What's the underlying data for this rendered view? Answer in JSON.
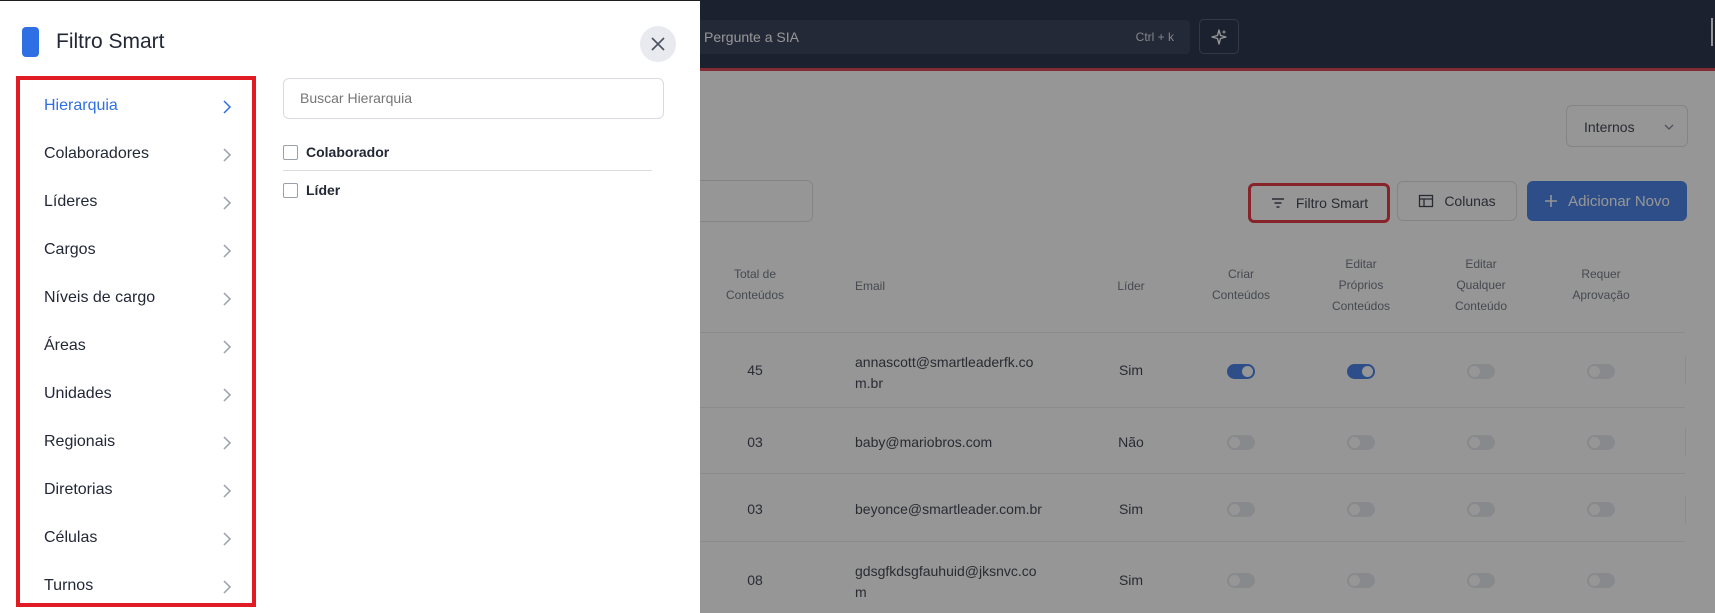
{
  "topbar": {
    "ask_placeholder": "Pergunte a SIA",
    "ask_shortcut": "Ctrl + k",
    "sparkle_icon": "sparkle-icon"
  },
  "toolbar": {
    "internos_value": "Internos",
    "filter_label": "Filtro Smart",
    "columns_label": "Colunas",
    "add_label": "Adicionar Novo",
    "accent_color": "#2f6fe4",
    "highlight_color": "#e01b24"
  },
  "table": {
    "headers": {
      "total": [
        "Total de",
        "Conteúdos"
      ],
      "email": "Email",
      "lider": "Líder",
      "criar": [
        "Criar",
        "Conteúdos"
      ],
      "editar_proprios": [
        "Editar",
        "Próprios",
        "Conteúdos"
      ],
      "editar_qualquer": [
        "Editar",
        "Qualquer",
        "Conteúdo"
      ],
      "requer": [
        "Requer",
        "Aprovação"
      ]
    },
    "rows": [
      {
        "total": "45",
        "email": [
          "annascott@smartleaderfk.co",
          "m.br"
        ],
        "lider": "Sim",
        "criar": true,
        "editar_proprios": true,
        "editar_qualquer": false,
        "requer": false
      },
      {
        "total": "03",
        "email": [
          "baby@mariobros.com"
        ],
        "lider": "Não",
        "criar": false,
        "editar_proprios": false,
        "editar_qualquer": false,
        "requer": false
      },
      {
        "total": "03",
        "email": [
          "beyonce@smartleader.com.br"
        ],
        "lider": "Sim",
        "criar": false,
        "editar_proprios": false,
        "editar_qualquer": false,
        "requer": false
      },
      {
        "total": "08",
        "email": [
          "gdsgfkdsgfauhuid@jksnvc.co",
          "m"
        ],
        "lider": "Sim",
        "criar": false,
        "editar_proprios": false,
        "editar_qualquer": false,
        "requer": false
      }
    ]
  },
  "drawer": {
    "title": "Filtro Smart",
    "categories": [
      "Hierarquia",
      "Colaboradores",
      "Líderes",
      "Cargos",
      "Níveis de cargo",
      "Áreas",
      "Unidades",
      "Regionais",
      "Diretorias",
      "Células",
      "Turnos"
    ],
    "active_category": "Hierarquia",
    "search_placeholder": "Buscar Hierarquia",
    "options": [
      "Colaborador",
      "Líder"
    ]
  }
}
